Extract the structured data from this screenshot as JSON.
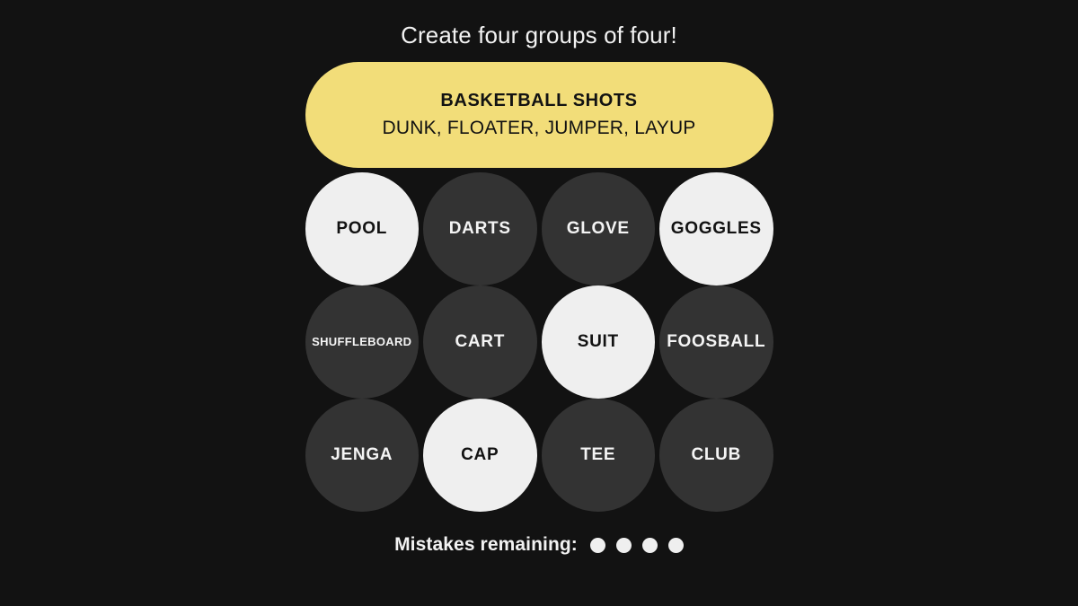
{
  "colors": {
    "background": "#121212",
    "tile_default_bg": "#333333",
    "tile_default_text": "#f4f4f4",
    "tile_selected_bg": "#efefef",
    "tile_selected_text": "#121212",
    "solved_yellow": "#f2dd79",
    "title_text": "#f2f2f2",
    "dot": "#efefef"
  },
  "header": {
    "title": "Create four groups of four!"
  },
  "solved_groups": [
    {
      "category": "BASKETBALL SHOTS",
      "members": "DUNK, FLOATER, JUMPER, LAYUP",
      "color": "#f2dd79"
    }
  ],
  "grid": {
    "rows": [
      [
        {
          "label": "POOL",
          "state": "selected",
          "size": "normal"
        },
        {
          "label": "DARTS",
          "state": "default",
          "size": "normal"
        },
        {
          "label": "GLOVE",
          "state": "default",
          "size": "normal"
        },
        {
          "label": "GOGGLES",
          "state": "selected",
          "size": "normal"
        }
      ],
      [
        {
          "label": "SHUFFLEBOARD",
          "state": "default",
          "size": "small"
        },
        {
          "label": "CART",
          "state": "default",
          "size": "normal"
        },
        {
          "label": "SUIT",
          "state": "selected",
          "size": "normal"
        },
        {
          "label": "FOOSBALL",
          "state": "default",
          "size": "normal"
        }
      ],
      [
        {
          "label": "JENGA",
          "state": "default",
          "size": "normal"
        },
        {
          "label": "CAP",
          "state": "selected",
          "size": "normal"
        },
        {
          "label": "TEE",
          "state": "default",
          "size": "normal"
        },
        {
          "label": "CLUB",
          "state": "default",
          "size": "normal"
        }
      ]
    ]
  },
  "footer": {
    "mistakes_label": "Mistakes remaining:",
    "mistakes_remaining": 4
  }
}
